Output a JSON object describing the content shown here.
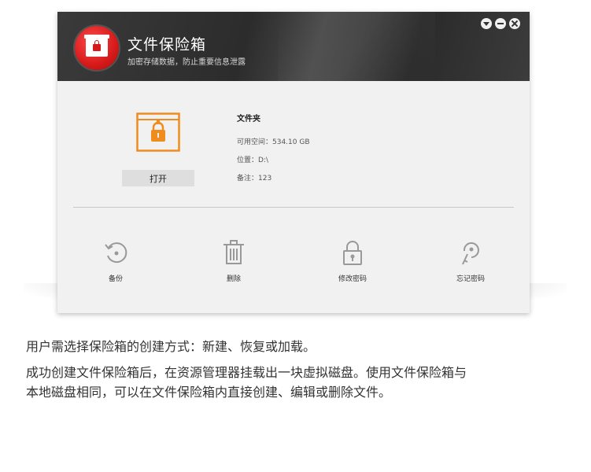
{
  "app": {
    "title": "文件保险箱",
    "subtitle": "加密存储数据，防止重要信息泄露"
  },
  "vault": {
    "open_label": "打开",
    "name": "文件夹",
    "free_space": "可用空间：534.10 GB",
    "location": "位置：D:\\",
    "note": "备注：123"
  },
  "actions": {
    "backup": "备份",
    "delete": "删除",
    "change_password": "修改密码",
    "forgot_password": "忘记密码"
  },
  "description": {
    "line1": "用户需选择保险箱的创建方式：新建、恢复或加载。",
    "line2": "成功创建文件保险箱后，在资源管理器挂载出一块虚拟磁盘。使用文件保险箱与",
    "line3": "本地磁盘相同，可以在文件保险箱内直接创建、编辑或删除文件。"
  },
  "icons": {
    "logo": "safe-logo-icon",
    "vault": "vault-lock-icon",
    "backup": "backup-icon",
    "delete": "trash-icon",
    "change_password": "lock-icon",
    "forgot_password": "key-icon"
  },
  "colors": {
    "accent_orange": "#f08c1e",
    "logo_red": "#d61a1a",
    "header_dark": "#2f2f2f"
  }
}
